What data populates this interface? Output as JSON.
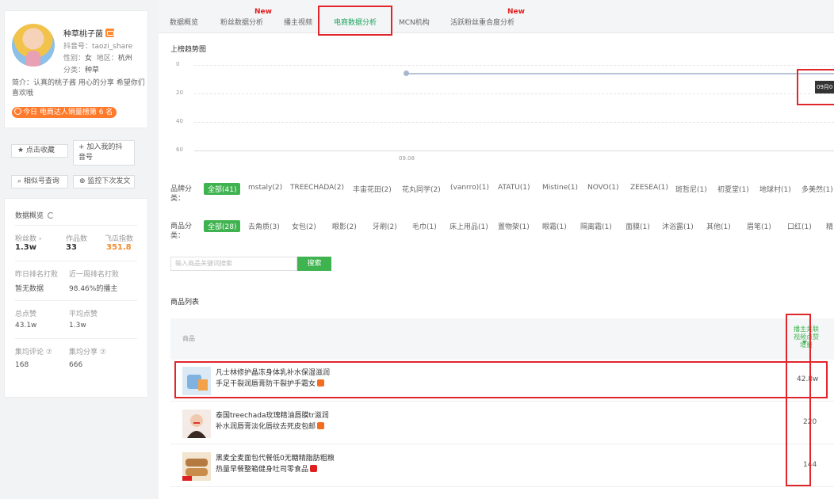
{
  "profile": {
    "name": "种草桃子菌",
    "douyin_id": "抖音号：taozi_share",
    "gender": "性别：",
    "gender_value": "女",
    "region": "地区：",
    "region_value": "杭州",
    "category": "分类：",
    "category_value": "种草",
    "bio": "简介：认真的桃子酱 用心的分享 希望你们喜欢哦",
    "rank_badge": "今日 电商达人销量榜第 6 名"
  },
  "actions": {
    "favorite": "★ 点击收藏",
    "add_to_mine": "+ 加入我的抖音号",
    "similar": "相似号查询",
    "monitor": "监控下次发文"
  },
  "stats": {
    "title": "数据概览",
    "fans_label": "粉丝数 ›",
    "fans_value": "1.3w",
    "works_label": "作品数",
    "works_value": "33",
    "feigua_label": "飞瓜指数",
    "feigua_value": "351.8",
    "yesterday_rank_label": "昨日排名打败",
    "yesterday_rank_value": "暂无数据",
    "week_rank_label": "近一周排名打败",
    "week_rank_value": "98.46%的播主",
    "total_likes_label": "总点赞",
    "total_likes_value": "43.1w",
    "avg_likes_label": "平均点赞",
    "avg_likes_value": "1.3w",
    "avg_comments_label": "集均评论 ⑦",
    "avg_comments_value": "168",
    "avg_shares_label": "集均分享 ⑦",
    "avg_shares_value": "666"
  },
  "tabs": [
    {
      "label": "数据概览",
      "new": false
    },
    {
      "label": "粉丝数据分析",
      "new": true
    },
    {
      "label": "播主视频",
      "new": false
    },
    {
      "label": "电商数据分析",
      "new": false,
      "active": true
    },
    {
      "label": "MCN机构",
      "new": false
    },
    {
      "label": "活跃粉丝重合度分析",
      "new": true
    }
  ],
  "new_tag": "New",
  "trend": {
    "title": "上榜趋势图",
    "y_ticks": [
      "0",
      "20",
      "40",
      "60"
    ],
    "x_label": "09.08",
    "tooltip": "09月0"
  },
  "chart_data": {
    "type": "line",
    "title": "上榜趋势图",
    "x": [
      "09.08"
    ],
    "series": [
      {
        "values": [
          6
        ]
      }
    ],
    "ylim": [
      0,
      60
    ],
    "y_inverted": true,
    "grid": true
  },
  "brand_filter": {
    "label": "品牌分类：",
    "chips": [
      "全部(41)",
      "mstaly(2)",
      "TREECHADA(2)",
      "丰宙花田(2)",
      "花丸同学(2)",
      "(vanrro)(1)",
      "ATATU(1)",
      "Mistine(1)",
      "NOVO(1)",
      "ZEESEA(1)",
      "斑哲尼(1)",
      "初夏堂(1)",
      "地球村(1)",
      "多美然(1)"
    ]
  },
  "category_filter": {
    "label": "商品分类：",
    "chips": [
      "全部(28)",
      "去角质(3)",
      "女包(2)",
      "眼影(2)",
      "牙刷(2)",
      "毛巾(1)",
      "床上用品(1)",
      "置物架(1)",
      "眼霜(1)",
      "隔离霜(1)",
      "面膜(1)",
      "沐浴露(1)",
      "其他(1)",
      "眉笔(1)",
      "口红(1)",
      "精"
    ]
  },
  "search": {
    "placeholder": "输入商品关键词搜索",
    "button": "搜索"
  },
  "product_list": {
    "title": "商品列表",
    "col_product": "商品",
    "col_metric": "播主关联视频点赞增量",
    "rows": [
      {
        "title": "凡士林修护晶冻身体乳补水保湿滋润手足干裂润唇膏防干裂护手霜女",
        "metric": "42.8w"
      },
      {
        "title": "泰国treechada玫瑰精油唇膜tr滋润补水润唇膏淡化唇纹去死皮包邮",
        "metric": "220"
      },
      {
        "title": "黑麦全麦面包代餐低0无糖精脂肪粗粮热量早餐整箱健身吐司零食品",
        "metric": "144"
      }
    ]
  }
}
